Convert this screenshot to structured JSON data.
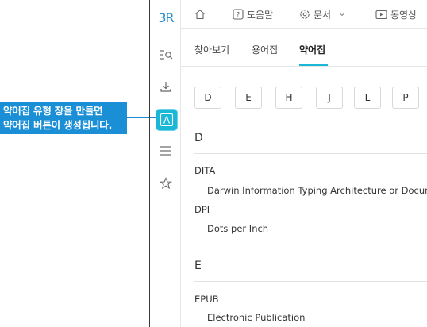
{
  "callout": {
    "line1": "약어집 유형 장을 만들면",
    "line2": "약어집 버튼이 생성됩니다."
  },
  "rail": {
    "logo": "3R",
    "items": [
      {
        "name": "search-list-icon"
      },
      {
        "name": "download-icon"
      },
      {
        "name": "abbreviation-icon",
        "label": "A",
        "active": true
      },
      {
        "name": "menu-icon"
      },
      {
        "name": "star-icon"
      }
    ]
  },
  "header": {
    "home_icon": "home-icon",
    "help_label": "도움말",
    "docs_label": "문서",
    "video_label": "동영상"
  },
  "tabs": [
    {
      "label": "찾아보기"
    },
    {
      "label": "용어집"
    },
    {
      "label": "약어집",
      "active": true
    }
  ],
  "letters": [
    "D",
    "E",
    "H",
    "J",
    "L",
    "P"
  ],
  "glossary": {
    "sections": [
      {
        "letter": "D",
        "entries": [
          {
            "term": "DITA",
            "definition": "Darwin Information Typing Architecture or Docume"
          },
          {
            "term": "DPI",
            "definition": "Dots per Inch"
          }
        ]
      },
      {
        "letter": "E",
        "entries": [
          {
            "term": "EPUB",
            "definition": "Electronic Publication"
          }
        ]
      }
    ]
  },
  "colors": {
    "accent": "#1ab8d6",
    "callout": "#1a8fd6"
  }
}
